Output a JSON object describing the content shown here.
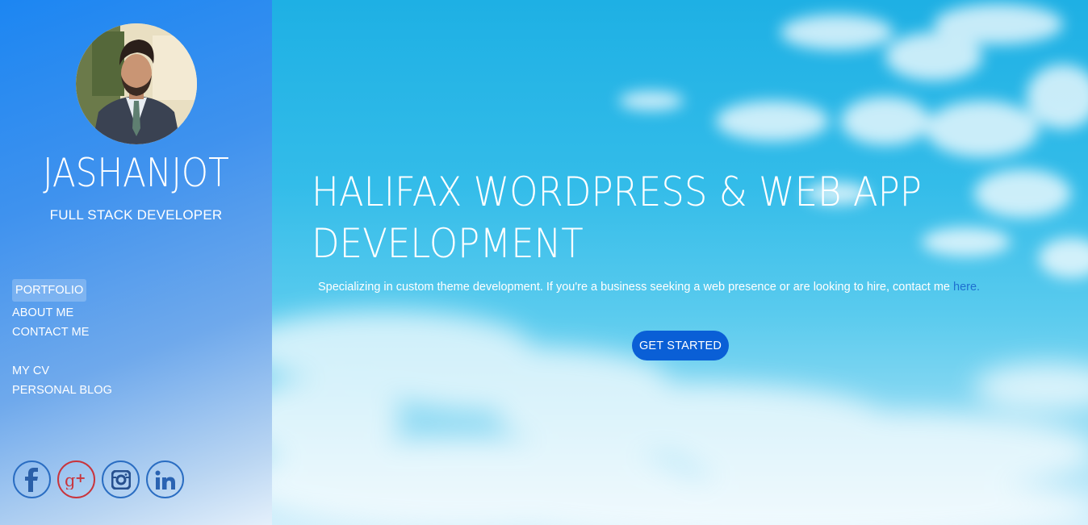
{
  "profile": {
    "name": "JASHANJOT",
    "role": "FULL STACK DEVELOPER"
  },
  "nav": {
    "primary": [
      {
        "label": "PORTFOLIO"
      },
      {
        "label": "ABOUT ME"
      },
      {
        "label": "CONTACT ME"
      }
    ],
    "secondary": [
      {
        "label": "MY CV"
      },
      {
        "label": "PERSONAL BLOG"
      }
    ]
  },
  "social": [
    {
      "icon": "facebook-icon"
    },
    {
      "icon": "google-plus-icon"
    },
    {
      "icon": "instagram-icon"
    },
    {
      "icon": "linkedin-icon"
    }
  ],
  "hero": {
    "headline_line1": "HALIFAX WORDPRESS & WEB APP",
    "headline_line2": "DEVELOPMENT",
    "subtitle": "Specializing in custom theme development. If you're a business seeking a web presence or are looking to hire, contact me ",
    "subtitle_link": "here.",
    "cta_label": "GET STARTED"
  },
  "colors": {
    "sidebar_start": "#1c86f2",
    "cta": "#0a5fd6",
    "link": "#1e6fd0",
    "facebook": "#2a6dc2",
    "google_plus": "#c9343c"
  }
}
